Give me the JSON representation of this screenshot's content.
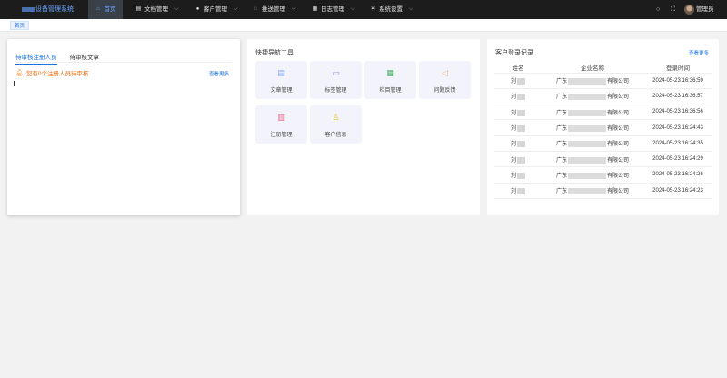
{
  "header": {
    "app_title": "设备管理系统",
    "nav": [
      {
        "label": "首页",
        "icon": "home-icon",
        "glyph": "⌂"
      },
      {
        "label": "文档管理",
        "icon": "document-icon",
        "glyph": "▤"
      },
      {
        "label": "客户管理",
        "icon": "user-icon",
        "glyph": "●"
      },
      {
        "label": "推送管理",
        "icon": "chat-icon",
        "glyph": "◌"
      },
      {
        "label": "日志管理",
        "icon": "calendar-icon",
        "glyph": "▦"
      },
      {
        "label": "系统设置",
        "icon": "gear-icon",
        "glyph": "✲"
      }
    ],
    "user_name": "管理员"
  },
  "tabs": {
    "home": "首页"
  },
  "pending": {
    "tab_users": "待审核注册人员",
    "tab_articles": "待审核文章",
    "notice": "您有0个注册人员待审核",
    "more": "查看更多"
  },
  "quick_tools": {
    "title": "快捷导航工具",
    "items": [
      {
        "label": "文章管理",
        "icon": "article-icon",
        "glyph": "▤",
        "color": "#7ea6f0"
      },
      {
        "label": "标签管理",
        "icon": "tag-icon",
        "glyph": "▭",
        "color": "#a88ee8"
      },
      {
        "label": "栏目管理",
        "icon": "column-icon",
        "glyph": "▦",
        "color": "#4caf6a"
      },
      {
        "label": "问题反馈",
        "icon": "feedback-icon",
        "glyph": "◁",
        "color": "#f2b37a"
      },
      {
        "label": "注册管理",
        "icon": "register-icon",
        "glyph": "▥",
        "color": "#e86a8a"
      },
      {
        "label": "客户信息",
        "icon": "customer-icon",
        "glyph": "♙",
        "color": "#e8c23a"
      }
    ]
  },
  "login_records": {
    "title": "客户登录记录",
    "more": "查看更多",
    "columns": [
      "姓名",
      "企业名称",
      "登录时间"
    ],
    "rows": [
      {
        "name": "刘",
        "company_prefix": "广东",
        "company_suffix": "有限公司",
        "time": "2024-05-23 16:36:59"
      },
      {
        "name": "刘",
        "company_prefix": "广东",
        "company_suffix": "有限公司",
        "time": "2024-05-23 16:36:57"
      },
      {
        "name": "刘",
        "company_prefix": "广东",
        "company_suffix": "有限公司",
        "time": "2024-05-23 16:36:56"
      },
      {
        "name": "刘",
        "company_prefix": "广东",
        "company_suffix": "有限公司",
        "time": "2024-05-23 16:24:43"
      },
      {
        "name": "刘",
        "company_prefix": "广东",
        "company_suffix": "有限公司",
        "time": "2024-05-23 16:24:35"
      },
      {
        "name": "刘",
        "company_prefix": "广东",
        "company_suffix": "有限公司",
        "time": "2024-05-23 16:24:29"
      },
      {
        "name": "刘",
        "company_prefix": "广东",
        "company_suffix": "有限公司",
        "time": "2024-05-23 16:24:26"
      },
      {
        "name": "刘",
        "company_prefix": "广东",
        "company_suffix": "有限公司",
        "time": "2024-05-23 16:24:23"
      }
    ]
  },
  "colors": {
    "accent": "#1a73e8",
    "warning": "#f56c0b",
    "nav_bg": "#1c1c1c"
  }
}
